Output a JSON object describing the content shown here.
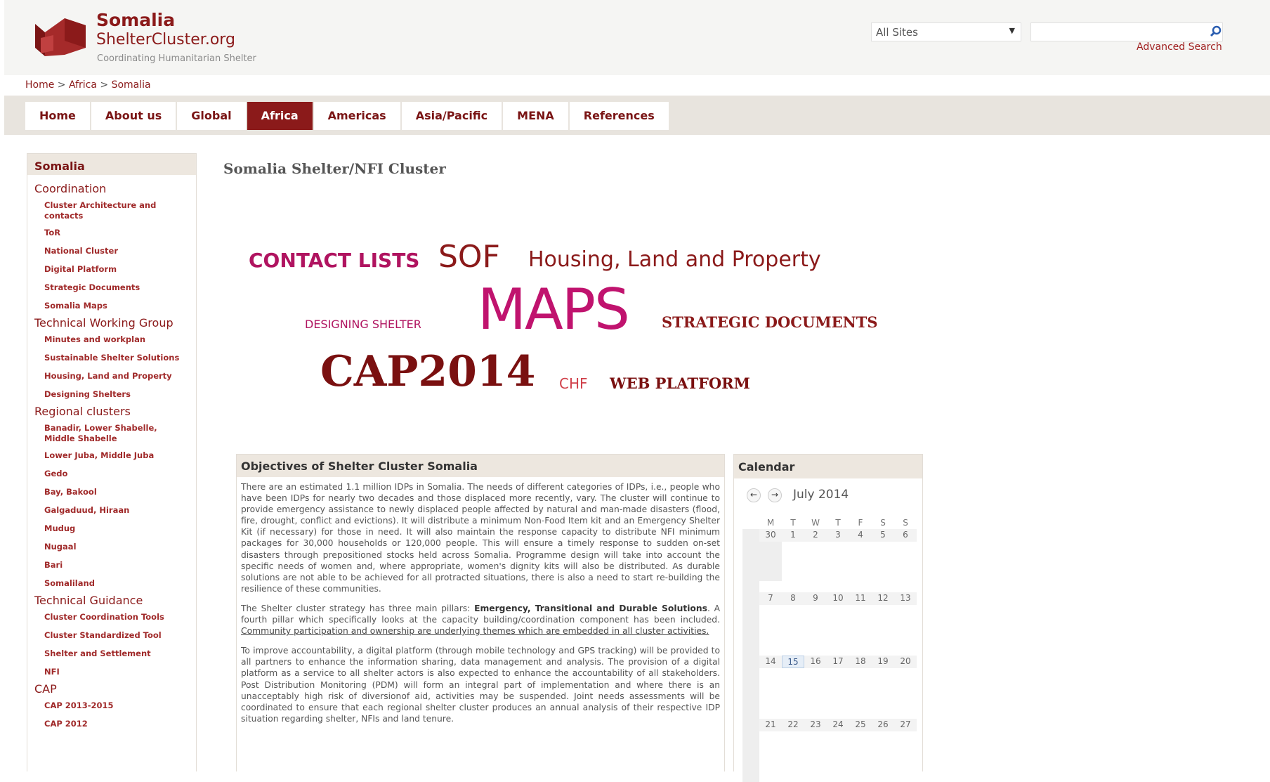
{
  "header": {
    "site_name": "Somalia",
    "site_domain": "ShelterCluster.org",
    "tagline": "Coordinating Humanitarian Shelter",
    "site_select": "All Sites",
    "advanced_search": "Advanced Search"
  },
  "breadcrumb": {
    "home": "Home",
    "sep1": ">",
    "region": "Africa",
    "sep2": ">",
    "current": "Somalia"
  },
  "nav": {
    "tabs": [
      {
        "label": "Home",
        "active": false
      },
      {
        "label": "About us",
        "active": false
      },
      {
        "label": "Global",
        "active": false
      },
      {
        "label": "Africa",
        "active": true
      },
      {
        "label": "Americas",
        "active": false
      },
      {
        "label": "Asia/Pacific",
        "active": false
      },
      {
        "label": "MENA",
        "active": false
      },
      {
        "label": "References",
        "active": false
      }
    ]
  },
  "sidebar": {
    "title": "Somalia",
    "coordination": "Coordination",
    "coord_items": [
      "Cluster Architecture and contacts",
      "ToR",
      "National Cluster",
      "Digital Platform",
      "Strategic Documents",
      "Somalia Maps"
    ],
    "twg": "Technical Working Group",
    "twg_items": [
      "Minutes and workplan",
      "Sustainable Shelter Solutions",
      "Housing, Land and Property",
      "Designing Shelters"
    ],
    "regional": "Regional clusters",
    "regional_items": [
      "Banadir, Lower Shabelle, Middle Shabelle",
      "Lower Juba, Middle Juba",
      "Gedo",
      "Bay, Bakool",
      "Galgaduud, Hiraan",
      "Mudug",
      "Nugaal",
      "Bari",
      "Somaliland"
    ],
    "guidance": "Technical Guidance",
    "guidance_items": [
      "Cluster Coordination Tools",
      "Cluster Standardized Tool",
      "Shelter and Settlement",
      "NFI"
    ],
    "cap": "CAP",
    "cap_items": [
      "CAP 2013-2015",
      "CAP 2012"
    ]
  },
  "main": {
    "page_title": "Somalia Shelter/NFI Cluster",
    "tags": {
      "contact_lists": "CONTACT LISTS",
      "sof": "SOF",
      "hlp": "Housing, Land and Property",
      "designing_shelter": "DESIGNING SHELTER",
      "maps": "MAPS",
      "strategic_documents": "STRATEGIC DOCUMENTS",
      "cap2014": "CAP2014",
      "chf": "CHF",
      "web_platform": "WEB PLATFORM"
    }
  },
  "objectives": {
    "title": "Objectives of Shelter Cluster Somalia",
    "p1": "There are an estimated 1.1 million IDPs in Somalia. The needs of different categories of IDPs, i.e., people who have been IDPs for nearly two decades and those displaced more recently, vary. The cluster will continue to provide emergency assistance to newly displaced people affected by natural and man-made disasters (flood, fire, drought, conflict and evictions). It will distribute a minimum Non-Food Item kit and an Emergency Shelter Kit (if necessary) for those in need. It will also maintain the response capacity to distribute NFI minimum packages for 30,000 households or 120,000 people. This will ensure a timely response to sudden on-set disasters through prepositioned stocks held across Somalia. Programme design will take into account the specific needs of women and, where appropriate, women's dignity kits will also be distributed. As durable solutions are not able to be achieved for all protracted situations, there is also a need to start re-building the resilience of these communities.",
    "p2_start": "The Shelter cluster strategy has three main pillars: ",
    "p2_bold": "Emergency, Transitional and Durable Solutions",
    "p2_mid": ". A fourth pillar which specifically looks at the capacity building/coordination component has been included. ",
    "p2_underline": "Community participation and ownership are underlying themes which are embedded in all cluster activities.",
    "p3": "To improve accountability, a digital platform (through mobile technology and GPS tracking) will be provided to all partners to enhance the information sharing, data management and analysis. The provision of a digital platform as a service to all shelter actors is also expected to enhance the accountability of all stakeholders. Post Distribution Monitoring (PDM) will form an integral part of implementation and where there is an unacceptably high risk of diversionof aid, activities may be suspended. Joint needs assessments will be coordinated to ensure that each regional shelter cluster produces an annual analysis of their respective IDP situation regarding shelter, NFIs and land tenure."
  },
  "calendar": {
    "title": "Calendar",
    "month": "July 2014",
    "weekdays": [
      "M",
      "T",
      "W",
      "T",
      "F",
      "S",
      "S"
    ],
    "weeks": [
      [
        "30",
        "1",
        "2",
        "3",
        "4",
        "5",
        "6"
      ],
      [
        "7",
        "8",
        "9",
        "10",
        "11",
        "12",
        "13"
      ],
      [
        "14",
        "15",
        "16",
        "17",
        "18",
        "19",
        "20"
      ],
      [
        "21",
        "22",
        "23",
        "24",
        "25",
        "26",
        "27"
      ]
    ],
    "today": "15"
  },
  "colors": {
    "brand": "#8b1a1a",
    "magenta": "#c0136e",
    "active_tab": "#8b1a1a"
  }
}
